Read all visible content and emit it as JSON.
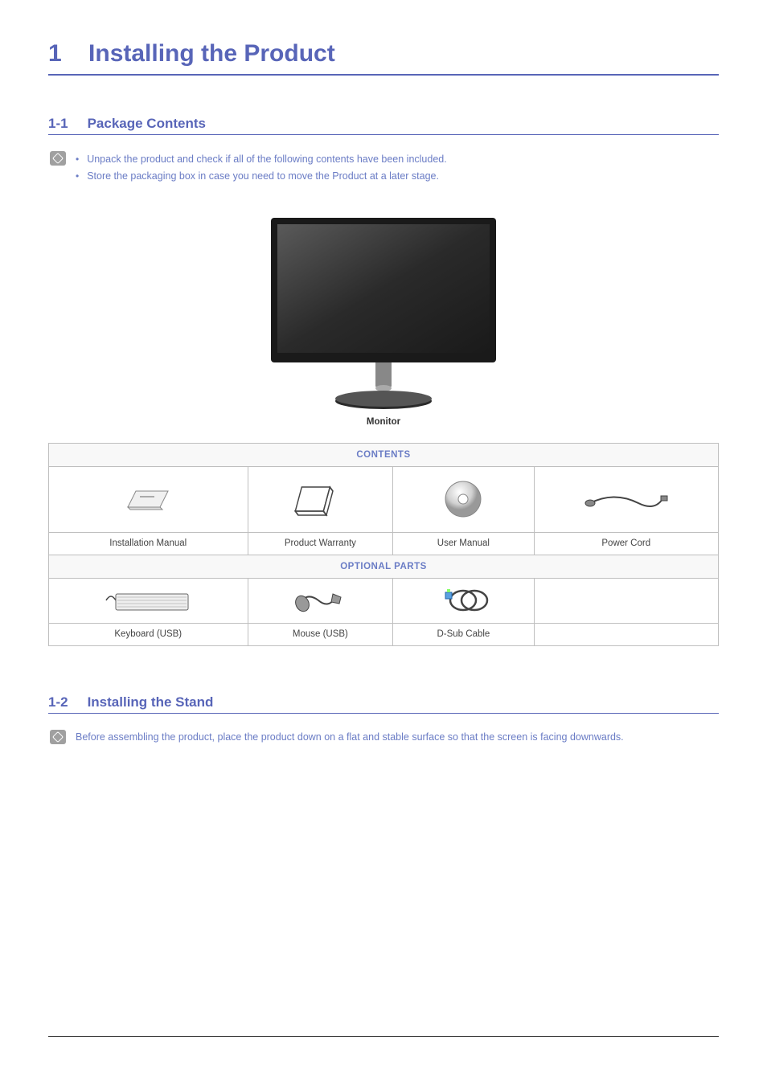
{
  "chapter": {
    "number": "1",
    "title": "Installing the Product"
  },
  "section1": {
    "number": "1-1",
    "title": "Package Contents",
    "notes": [
      "Unpack the product and check if all of the following contents have been included.",
      "Store the packaging box in case you need to move the Product at a later stage."
    ]
  },
  "monitor_label": "Monitor",
  "contents_table": {
    "header": "CONTENTS",
    "items": [
      "Installation Manual",
      "Product Warranty",
      "User Manual",
      "Power Cord"
    ]
  },
  "optional_table": {
    "header": "OPTIONAL PARTS",
    "items": [
      "Keyboard (USB)",
      "Mouse (USB)",
      "D-Sub Cable",
      ""
    ]
  },
  "section2": {
    "number": "1-2",
    "title": "Installing the Stand",
    "note": "Before assembling the product, place the product down on a flat and stable surface so that the screen is facing downwards."
  }
}
